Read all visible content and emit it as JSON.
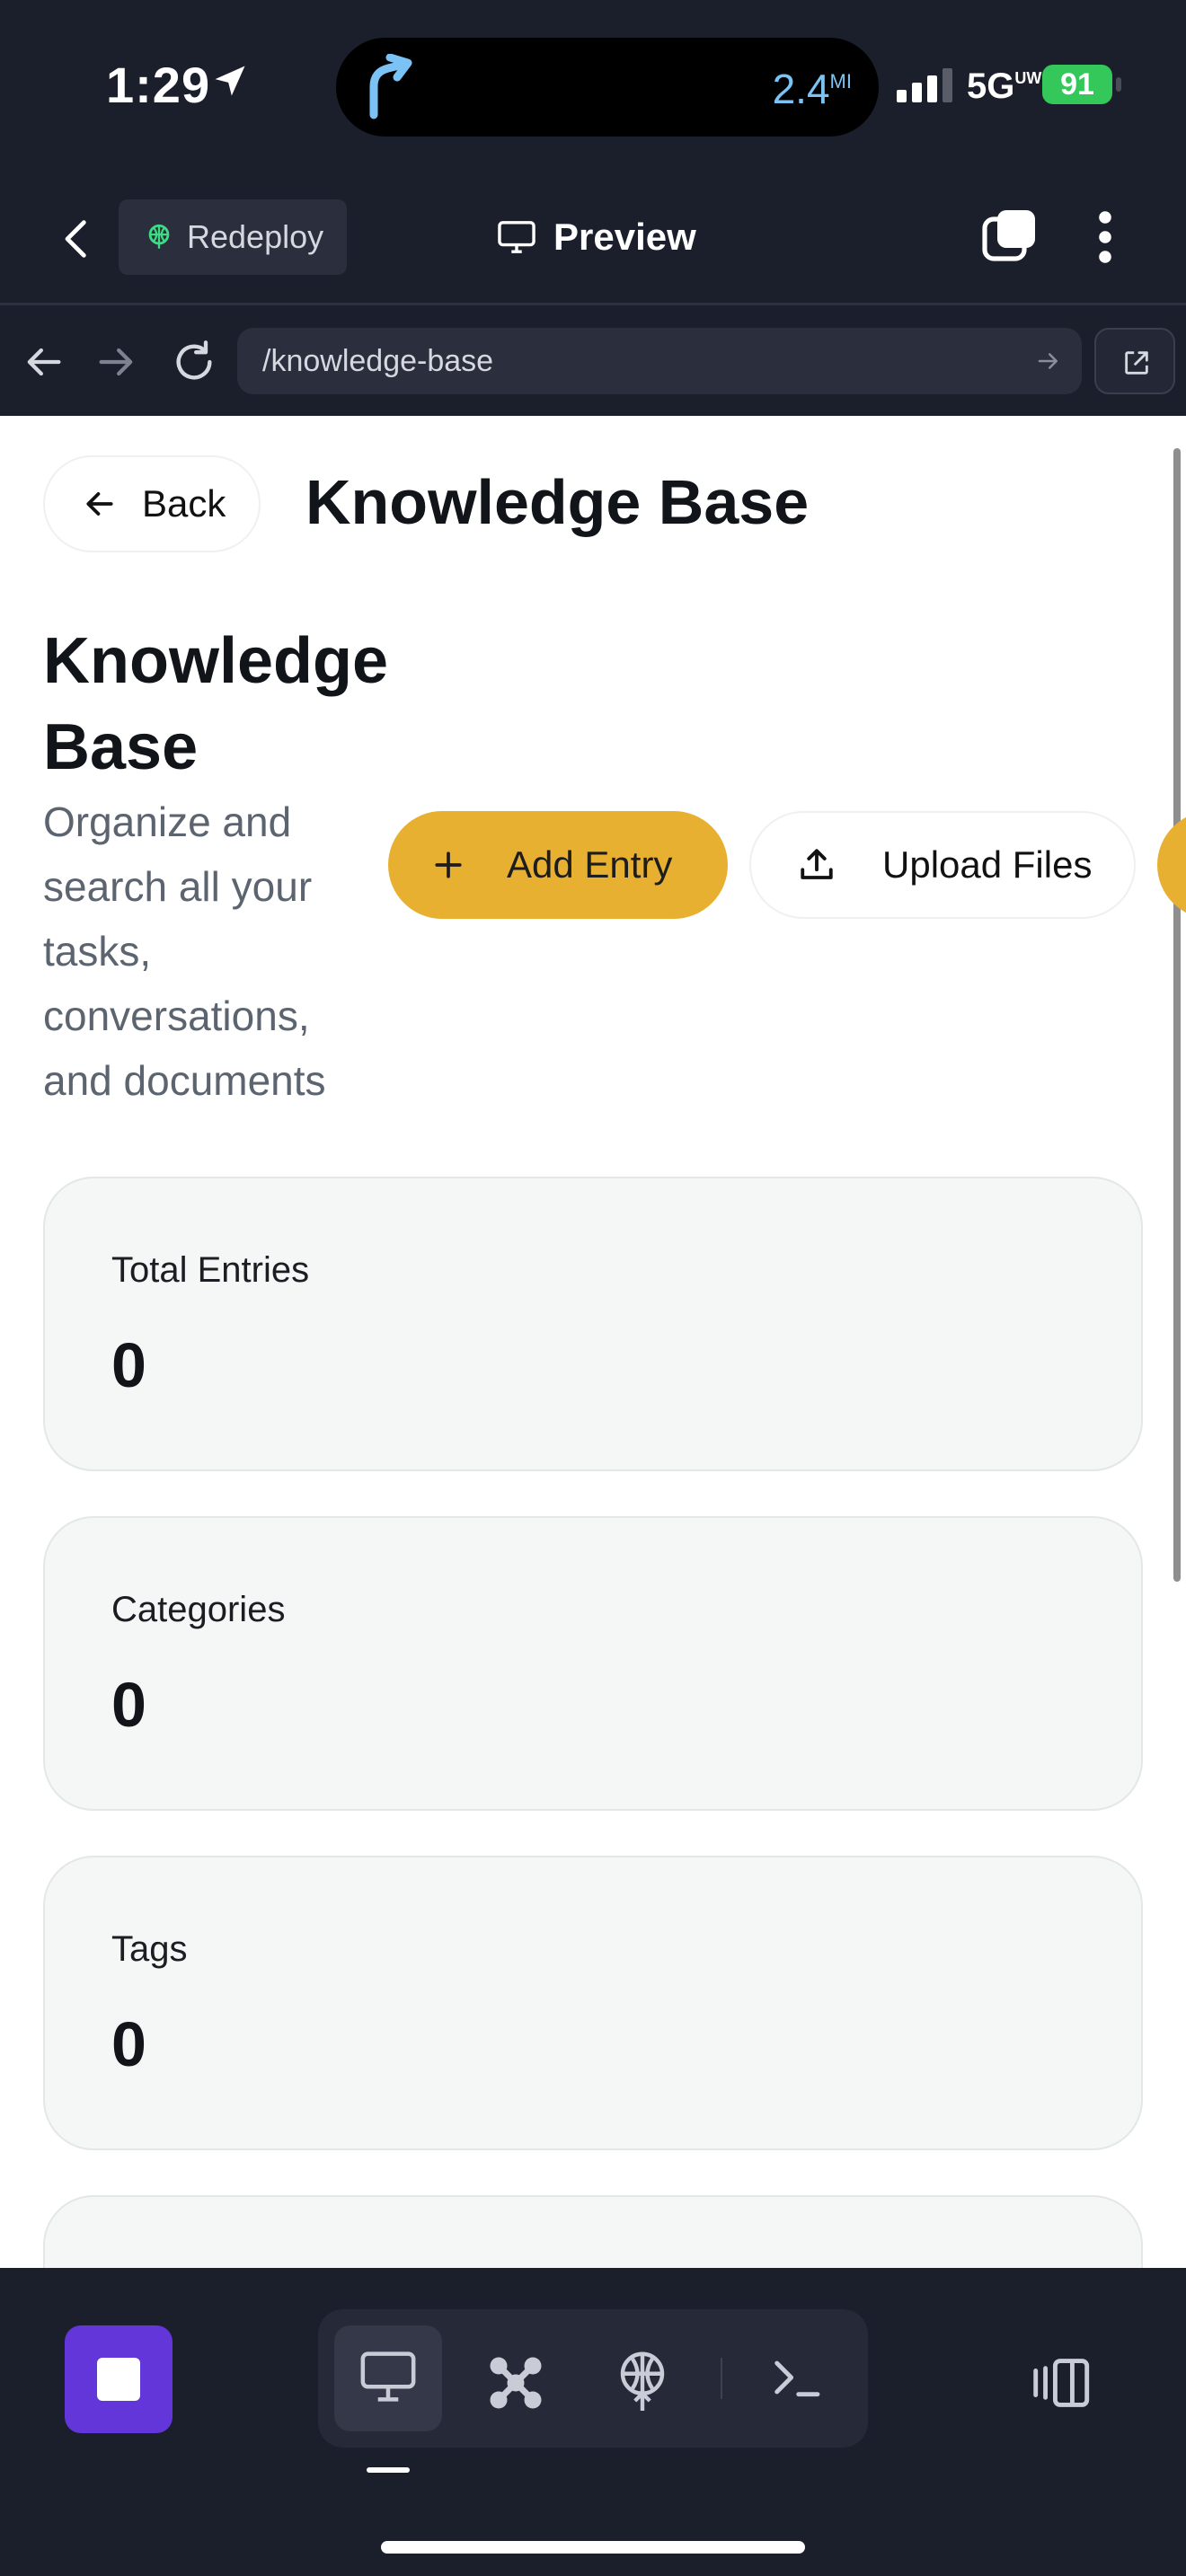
{
  "status_bar": {
    "time": "1:29",
    "distance": "2.4",
    "distance_unit": "MI",
    "network": "5G",
    "network_sub": "UW",
    "battery": "91"
  },
  "app_toolbar": {
    "redeploy_label": "Redeploy",
    "preview_label": "Preview"
  },
  "url_bar": {
    "url": "/knowledge-base"
  },
  "page": {
    "back_label": "Back",
    "top_title": "Knowledge Base",
    "hero_title": "Knowledge Base",
    "hero_subtitle": "Organize and search all your tasks, conversations, and documents",
    "add_entry_label": "Add Entry",
    "upload_files_label": "Upload Files",
    "stats": [
      {
        "label": "Total Entries",
        "value": "0"
      },
      {
        "label": "Categories",
        "value": "0"
      },
      {
        "label": "Tags",
        "value": "0"
      }
    ]
  },
  "colors": {
    "accent": "#e8b030",
    "stop_button": "#6236d8",
    "chrome_bg": "#1b1e2b",
    "battery": "#34c759"
  },
  "icons": {
    "status": [
      "location-arrow-icon",
      "navigation-turn-icon",
      "signal-icon"
    ],
    "toolbar": [
      "chevron-left-icon",
      "redeploy-icon",
      "monitor-icon",
      "tabs-icon",
      "kebab-icon"
    ],
    "url": [
      "arrow-left-icon",
      "arrow-right-icon",
      "reload-icon",
      "go-arrow-icon",
      "external-link-icon"
    ],
    "bottom": [
      "stop-icon",
      "monitor-icon",
      "workflow-icon",
      "deploy-icon",
      "terminal-icon",
      "panel-toggle-icon"
    ]
  }
}
